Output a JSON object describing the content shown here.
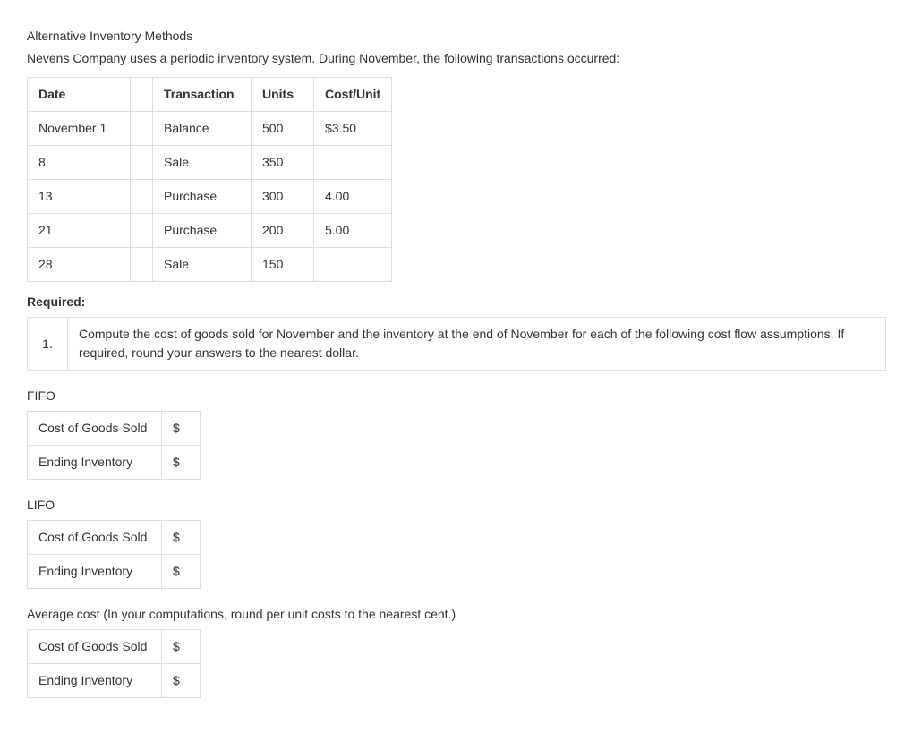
{
  "title": "Alternative Inventory Methods",
  "intro": "Nevens Company uses a periodic inventory system. During November, the following transactions occurred:",
  "transactions": {
    "headers": {
      "date": "Date",
      "txn": "Transaction",
      "units": "Units",
      "cost": "Cost/Unit"
    },
    "rows": [
      {
        "date": "November 1",
        "txn": "Balance",
        "units": "500",
        "cost": "$3.50"
      },
      {
        "date": "8",
        "txn": "Sale",
        "units": "350",
        "cost": ""
      },
      {
        "date": "13",
        "txn": "Purchase",
        "units": "300",
        "cost": "4.00"
      },
      {
        "date": "21",
        "txn": "Purchase",
        "units": "200",
        "cost": "5.00"
      },
      {
        "date": "28",
        "txn": "Sale",
        "units": "150",
        "cost": ""
      }
    ]
  },
  "required_label": "Required:",
  "requirement": {
    "num": "1.",
    "text": "Compute the cost of goods sold for November and the inventory at the end of November for each of the following cost flow assumptions. If required, round your answers to the nearest dollar."
  },
  "sections": {
    "fifo": {
      "label": "FIFO",
      "cogs_label": "Cost of Goods Sold",
      "cogs_val": "$",
      "end_label": "Ending Inventory",
      "end_val": "$"
    },
    "lifo": {
      "label": "LIFO",
      "cogs_label": "Cost of Goods Sold",
      "cogs_val": "$",
      "end_label": "Ending Inventory",
      "end_val": "$"
    },
    "avg": {
      "label": "Average cost (In your computations, round per unit costs to the nearest cent.)",
      "cogs_label": "Cost of Goods Sold",
      "cogs_val": "$",
      "end_label": "Ending Inventory",
      "end_val": "$"
    }
  }
}
